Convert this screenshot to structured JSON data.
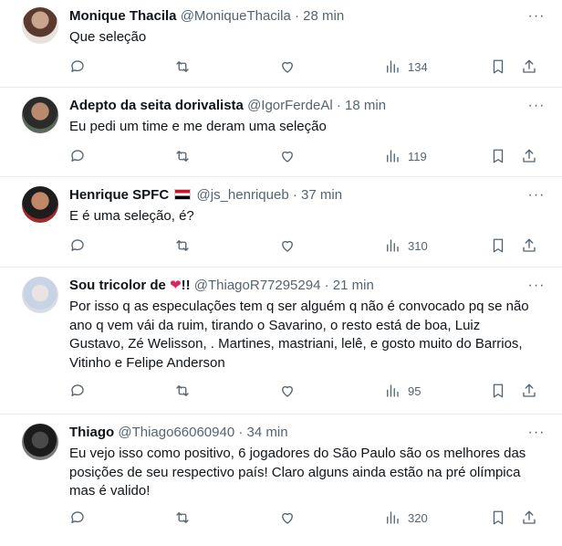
{
  "tweets": [
    {
      "name": "Monique Thacila",
      "handle": "@MoniqueThacila",
      "separator": "·",
      "time": "28 min",
      "text": "Que seleção",
      "views": "134"
    },
    {
      "name": "Adepto da seita dorivalista",
      "handle": "@IgorFerdeAl",
      "separator": "·",
      "time": "18 min",
      "text": "Eu pedi um time e me deram uma seleção",
      "views": "119"
    },
    {
      "name": "Henrique SPFC",
      "handle": "@js_henriqueb",
      "separator": "·",
      "time": "37 min",
      "text": "E é uma seleção, é?",
      "views": "310"
    },
    {
      "name_prefix": "Sou tricolor de",
      "name_suffix": "!!",
      "handle": "@ThiagoR77295294",
      "separator": "·",
      "time": "21 min",
      "text_lines": [
        "Por isso q as especulações tem q ser alguém q não é convocado pq se não",
        "ano q vem vái da ruim, tirando o Savarino, o resto está de boa, Luiz",
        "Gustavo, Zé Welisson, . Martines, mastriani, lelê, e gosto muito do Barrios,",
        "Vitinho e Felipe Anderson"
      ],
      "views": "95"
    },
    {
      "name": "Thiago",
      "handle": "@Thiago66060940",
      "separator": "·",
      "time": "34 min",
      "text_lines": [
        "Eu vejo isso como positivo, 6 jogadores do São Paulo são os melhores das",
        "posições de seu respectivo país! Claro alguns ainda estão na pré olímpica",
        "mas é valido!"
      ],
      "views": "320"
    }
  ],
  "icons": {
    "more": "more-dots-icon",
    "reply": "reply-icon",
    "retweet": "retweet-icon",
    "like": "like-icon",
    "views": "views-icon",
    "bookmark": "bookmark-icon",
    "share": "share-icon",
    "flag": "egypt-flag-icon",
    "heart": "red-heart-icon"
  },
  "colors": {
    "text": "#0f1419",
    "secondary": "#536471",
    "divider": "#e6ecf0",
    "heart": "#e0245e"
  },
  "more_glyph": "···"
}
